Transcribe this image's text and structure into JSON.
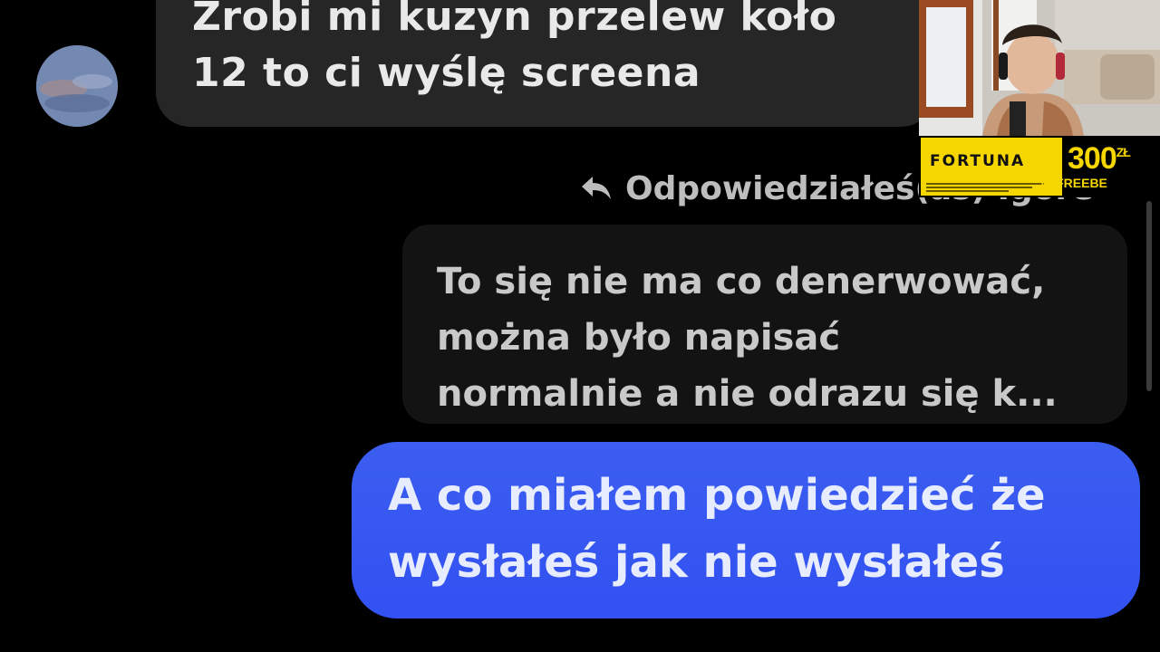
{
  "incoming": {
    "text": "Zrobi mi kuzyn przelew koło\n12 to ci wyślę screena"
  },
  "reply": {
    "label": "Odpowiedziałeś(aś) Igore"
  },
  "quoted": {
    "text": "To się nie ma co denerwować,\nmożna było napisać\nnormalnie a nie odrazu się k..."
  },
  "outgoing": {
    "text": "A co miałem powiedzieć że\nwysłałeś jak nie wysłałeś"
  },
  "sponsor": {
    "brand": "FORTUNA",
    "amount": "300",
    "unit": "ZŁ",
    "subtitle": "W FREEBE"
  },
  "colors": {
    "outgoing_bubble": "#3251f2",
    "incoming_bubble": "#262626",
    "sponsor_yellow": "#f6d600"
  },
  "icons": {
    "reply": "reply-arrow-icon"
  }
}
